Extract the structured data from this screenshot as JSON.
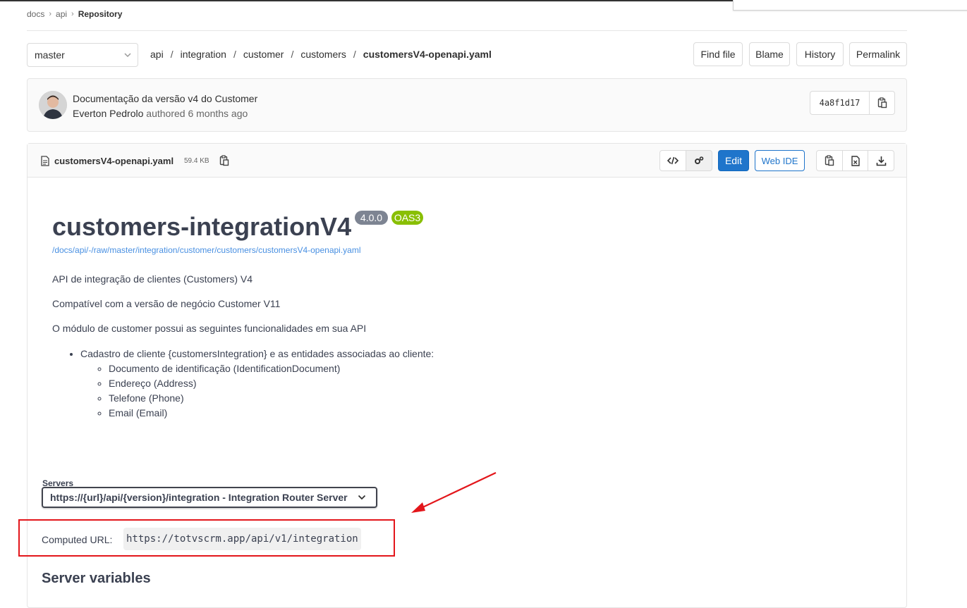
{
  "breadcrumb": {
    "items": [
      "docs",
      "api"
    ],
    "current": "Repository"
  },
  "branch": {
    "selected": "master"
  },
  "path": {
    "segments": [
      "api",
      "integration",
      "customer",
      "customers"
    ],
    "file": "customersV4-openapi.yaml"
  },
  "toolbar": {
    "find_file": "Find file",
    "blame": "Blame",
    "history": "History",
    "permalink": "Permalink"
  },
  "commit": {
    "title": "Documentação da versão v4 do Customer",
    "author": "Everton Pedrolo",
    "authored_text": "authored 6 months ago",
    "sha": "4a8f1d17"
  },
  "file": {
    "name": "customersV4-openapi.yaml",
    "size": "59.4 KB",
    "edit_label": "Edit",
    "web_ide_label": "Web IDE"
  },
  "swagger": {
    "title": "customers-integrationV4",
    "version_badge": "4.0.0",
    "oas_badge": "OAS3",
    "raw_link": "/docs/api/-/raw/master/integration/customer/customers/customersV4-openapi.yaml",
    "desc1": "API de integração de clientes (Customers) V4",
    "desc2": "Compatível com a versão de negócio Customer V11",
    "desc3": "O módulo de customer possui as seguintes funcionalidades em sua API",
    "list_item": "Cadastro de cliente {customersIntegration} e as entidades associadas ao cliente:",
    "sub_items": [
      "Documento de identificação (IdentificationDocument)",
      "Endereço (Address)",
      "Telefone (Phone)",
      "Email (Email)"
    ],
    "servers_label": "Servers",
    "server_selected": "https://{url}/api/{version}/integration - Integration Router Server",
    "computed_label": "Computed URL:",
    "computed_url": "https://totvscrm.app/api/v1/integration",
    "server_vars_heading": "Server variables"
  },
  "colors": {
    "primary": "#1f75cb",
    "annotation_red": "#e3161b",
    "badge_gray": "#7d8492",
    "badge_green": "#89bf04"
  }
}
